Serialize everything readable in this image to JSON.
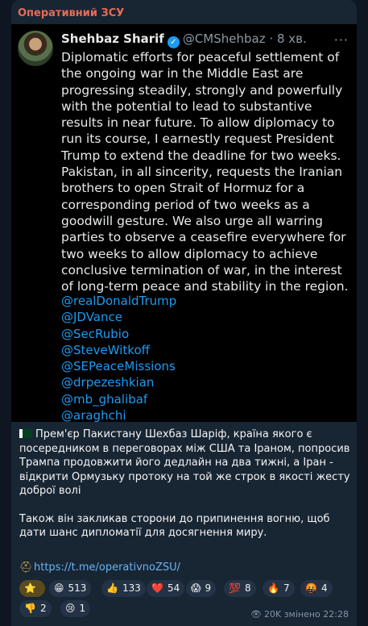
{
  "channel": {
    "name": "Оперативний ЗСУ"
  },
  "tweet": {
    "author_name": "Shehbaz Sharif",
    "handle": "@CMShehbaz",
    "separator": "·",
    "time": "8 хв.",
    "text": "Diplomatic efforts for peaceful settlement of the ongoing war in the Middle East are progressing steadily, strongly and powerfully with the potential to lead to substantive results in near future. To allow diplomacy to run its course, I earnestly request President Trump to extend the deadline for two weeks. Pakistan, in all sincerity, requests the Iranian brothers to open Strait of Hormuz for a corresponding period of two weeks as a goodwill gesture. We also urge all warring parties to observe a ceasefire everywhere for two weeks to allow diplomacy to achieve conclusive termination of war, in the interest of long-term peace and stability in the region.",
    "mentions": [
      "@realDonaldTrump",
      "@JDVance",
      "@SecRubio",
      "@SteveWitkoff",
      "@SEPeaceMissions",
      "@drpezeshkian",
      "@mb_ghalibaf",
      "@araghchi"
    ]
  },
  "caption": {
    "para1": "Прем'єр Пакистану Шехбаз Шаріф, країна якого є посередником в переговорах між США та Іраном, попросив Трампа продовжити його дедлайн на два тижні, а Іран - відкрити Ормузьку протоку на той же строк в якості жесту доброї волі",
    "para2": "Також він закликав сторони до припинення вогню, щоб дати шанс дипломатії для досягнення миру.",
    "link": "https://t.me/operativnoZSU/"
  },
  "reactions": [
    {
      "emoji": "⭐",
      "count": ""
    },
    {
      "emoji": "😁",
      "count": "513"
    },
    {
      "emoji": "👍",
      "count": "133"
    },
    {
      "emoji": "❤️",
      "count": "54"
    },
    {
      "emoji": "😱",
      "count": "9"
    },
    {
      "emoji": "💯",
      "count": "8"
    },
    {
      "emoji": "🔥",
      "count": "7"
    },
    {
      "emoji": "🤬",
      "count": "4"
    },
    {
      "emoji": "👎",
      "count": "2"
    },
    {
      "emoji": "😢",
      "count": "1"
    }
  ],
  "footer": {
    "views": "20K",
    "edited": "змінено",
    "time": "22:28"
  },
  "icons": {
    "verified": "verified-badge-icon",
    "more": "more-icon",
    "views": "eye-icon",
    "link": "military-helmet-icon"
  },
  "colors": {
    "channel_name": "#e86a57",
    "link": "#6ab3f3",
    "mention": "#1d9bf0",
    "bubble": "#182533"
  }
}
